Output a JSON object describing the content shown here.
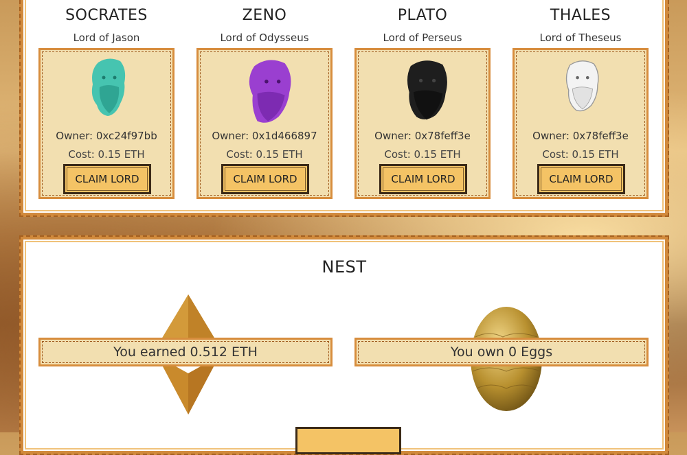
{
  "lords": [
    {
      "name": "SOCRATES",
      "subtitle": "Lord of Jason",
      "owner": "Owner: 0xc24f97bb",
      "cost": "Cost: 0.15 ETH",
      "button": "CLAIM LORD",
      "bust_color": "#46c4b0"
    },
    {
      "name": "ZENO",
      "subtitle": "Lord of Odysseus",
      "owner": "Owner: 0x1d466897",
      "cost": "Cost: 0.15 ETH",
      "button": "CLAIM LORD",
      "bust_color": "#9a3fd0"
    },
    {
      "name": "PLATO",
      "subtitle": "Lord of Perseus",
      "owner": "Owner: 0x78feff3e",
      "cost": "Cost: 0.15 ETH",
      "button": "CLAIM LORD",
      "bust_color": "#1e1e1e"
    },
    {
      "name": "THALES",
      "subtitle": "Lord of Theseus",
      "owner": "Owner: 0x78feff3e",
      "cost": "Cost: 0.15 ETH",
      "button": "CLAIM LORD",
      "bust_color": "#f3f3f3"
    }
  ],
  "nest": {
    "title": "NEST",
    "earned": "You earned 0.512 ETH",
    "eggs": "You own 0 Eggs"
  },
  "colors": {
    "accent": "#d18a3c",
    "card_bg": "#f2dfb0",
    "button_bg": "#f4c365",
    "eth_gold": "#c98a2c"
  }
}
